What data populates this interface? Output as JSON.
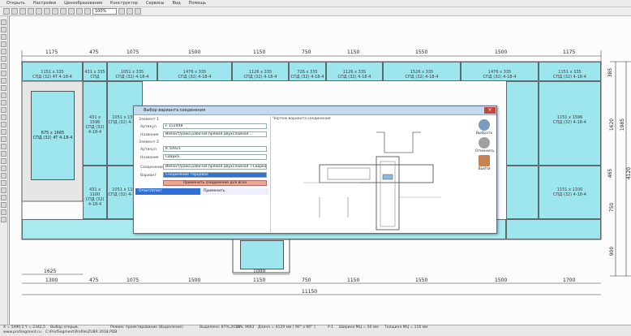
{
  "menu": [
    "Открыть",
    "Настройки",
    "Ценообразования",
    "Конструктор",
    "Сервисы",
    "Вид",
    "Помощь"
  ],
  "toolbar": {
    "zoom": "100%"
  },
  "top_dims": [
    "1175",
    "475",
    "1075",
    "1500",
    "1150",
    "750",
    "1150",
    "1550",
    "1500",
    "1175"
  ],
  "bottom_dims": [
    "1300",
    "475",
    "1075",
    "1500",
    "1150",
    "750",
    "1150",
    "1550",
    "1500",
    "1700"
  ],
  "bottom_sub_dims": [
    "1625",
    "1000"
  ],
  "total_width": "11150",
  "right_dims": [
    "385",
    "1620",
    "1985",
    "4120",
    "465",
    "750",
    "900"
  ],
  "panes": {
    "top_row": [
      "1151 x 335\nСПД (32) 4Т 4-18-4",
      "431 x 335\nСПД",
      "1051 x 335\nСПД (32) 4-18-4",
      "1476 x 335\nСПД (32) 4-18-4",
      "1126 x 335\nСПД (32) 4-18-4",
      "726 x 335\nСПД (32) 4-18-4",
      "1126 x 335\nСПД (32) 4-18-4",
      "1526 x 335\nСПД (32) 4-18-4",
      "1476 x 335\nСПД (32) 4-18-4",
      "1151 x 335\nСПД (32) 4-18-4"
    ],
    "door": "675 x 1665\nСПД (32) 4Т 4-18-4",
    "mid_left": "431 x 1596\nСПД (32) 4-18-4",
    "mid_left2": "1051 x 1596\nСПД (32) 4-18-4",
    "mid_right": "1151 x 1596\nСПД (32) 4-18-4",
    "low_left": "431 x 1100\nСПД (32) 4-18-4",
    "low_left2": "1051 x 1100\nСПД (32) 4-18-4",
    "low_right": "1151 x 1100\nСПД (32) 4-18-4"
  },
  "dialog": {
    "title": "Выбор варианта соединения",
    "element1_header": "Элемент 1",
    "element1_article_label": "Артикул",
    "element1_article": "F 152448",
    "element1_name_label": "Название",
    "element1_name": "Импост/рама рабочая прямая двухслойная ...",
    "element2_header": "Элемент 2",
    "element2_article_label": "Артикул",
    "element2_article": "K 50921",
    "element2_name_label": "Название",
    "element2_name": "Сварка",
    "joint_label": "Соединение",
    "joint_value": "Импост/рама рабочая прямая двухслойная T-Сварка",
    "variant_label": "Вариант",
    "variant_value": "Соединение торцевое",
    "pick_button": "Применить соединение для всех",
    "tab_label": "Ответ/ответ",
    "tab_right": "Применить",
    "drawing_title": "Чертеж варианта соединения",
    "side_buttons": [
      "Выбрать",
      "Отменить",
      "Выйти"
    ]
  },
  "status": {
    "line1": [
      "X = 5490,5  Y = 2342,5",
      "Выбор открыв.",
      "Режим: проектирование (Выделение)",
      "Выделено: 87%,2013",
      "RAL 9003",
      "Длина = 4129 мм [ 90° x 90° ]",
      "Р.1",
      "Ширина МЦ = 50 мм",
      "Толщина МЦ = 116 мм"
    ],
    "line2": [
      "www.profsegment.ru",
      "C:\\ProfSegment\\Profile\\ZUBR 2018.PDB"
    ]
  },
  "colors": {
    "glass": "#9ee6ee",
    "frame": "#5d6b70",
    "dialog_title": "#c5daef",
    "select": "#2f6fd6",
    "pick": "#e8a98d"
  }
}
